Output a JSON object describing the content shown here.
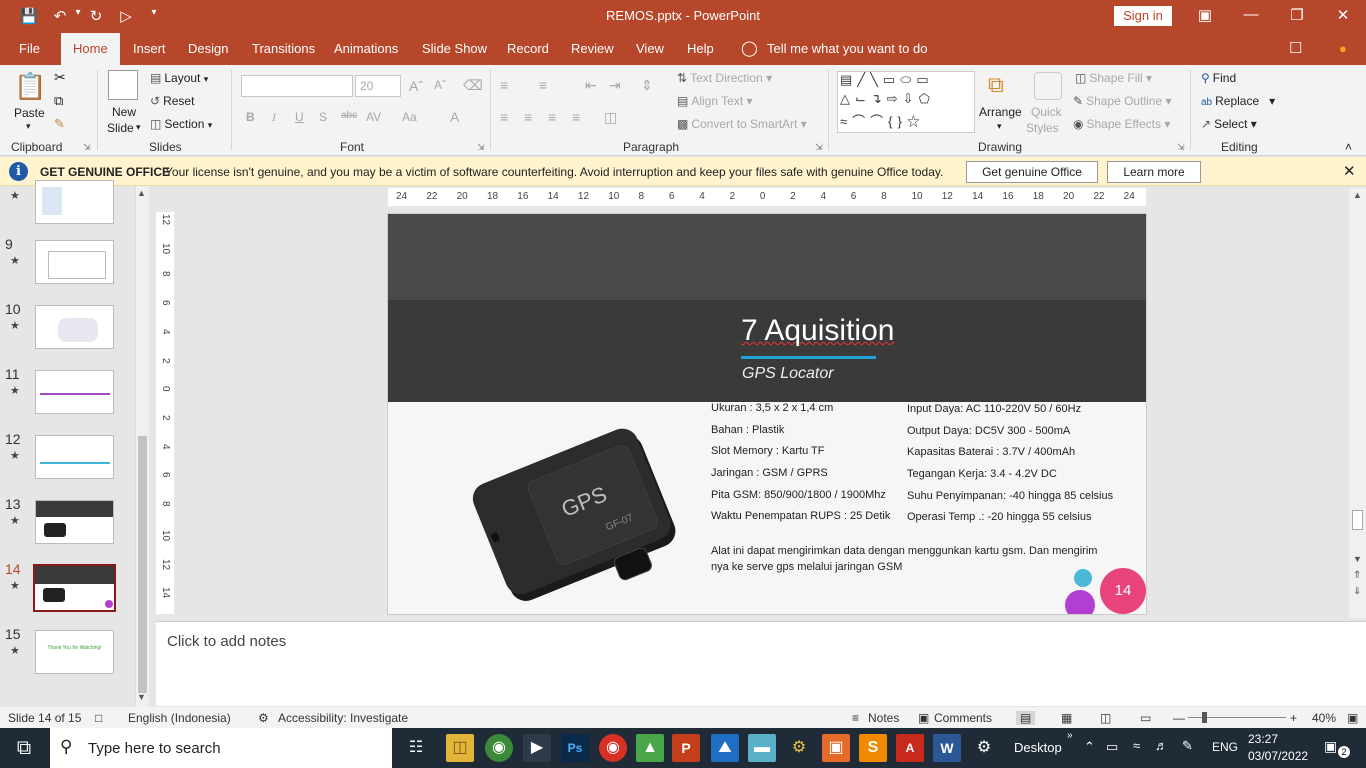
{
  "window": {
    "title": "REMOS.pptx  -  PowerPoint",
    "signin": "Sign in"
  },
  "tabs": [
    "File",
    "Home",
    "Insert",
    "Design",
    "Transitions",
    "Animations",
    "Slide Show",
    "Record",
    "Review",
    "View",
    "Help"
  ],
  "tell_me": "Tell me what you want to do",
  "ribbon": {
    "clipboard": {
      "label": "Clipboard",
      "paste": "Paste"
    },
    "slides": {
      "label": "Slides",
      "new_slide": "New",
      "new_slide2": "Slide",
      "layout": "Layout",
      "reset": "Reset",
      "section": "Section"
    },
    "font": {
      "label": "Font",
      "size": "20",
      "bold": "B",
      "italic": "I",
      "underline": "U",
      "shadow": "S",
      "strike": "abc",
      "spacing": "AV",
      "case": "Aa",
      "color": "A"
    },
    "paragraph": {
      "label": "Paragraph",
      "text_direction": "Text Direction",
      "align_text": "Align Text",
      "convert": "Convert to SmartArt"
    },
    "drawing": {
      "label": "Drawing",
      "arrange": "Arrange",
      "quick_styles": "Quick",
      "quick_styles2": "Styles",
      "shape_fill": "Shape Fill",
      "shape_outline": "Shape Outline",
      "shape_effects": "Shape Effects"
    },
    "editing": {
      "label": "Editing",
      "find": "Find",
      "replace": "Replace",
      "select": "Select"
    }
  },
  "license": {
    "title": "GET GENUINE OFFICE",
    "message": "Your license isn't genuine, and you may be a victim of software counterfeiting. Avoid interruption and keep your files safe with genuine Office today.",
    "btn_genuine": "Get genuine Office",
    "btn_learn": "Learn more"
  },
  "thumbnails": [
    {
      "num": "9"
    },
    {
      "num": "10"
    },
    {
      "num": "11"
    },
    {
      "num": "12"
    },
    {
      "num": "13"
    },
    {
      "num": "14"
    },
    {
      "num": "15",
      "text": "Thank You for Watching!"
    }
  ],
  "ruler_h": [
    "24",
    "22",
    "20",
    "18",
    "16",
    "14",
    "12",
    "10",
    "8",
    "6",
    "4",
    "2",
    "0",
    "2",
    "4",
    "6",
    "8",
    "10",
    "12",
    "14",
    "16",
    "18",
    "20",
    "22",
    "24"
  ],
  "ruler_v": [
    "12",
    "10",
    "8",
    "6",
    "4",
    "2",
    "0",
    "2",
    "4",
    "6",
    "8",
    "10",
    "12",
    "14"
  ],
  "slide": {
    "title": "7 Aquisition",
    "subtitle": "GPS Locator",
    "device_label": "GPS",
    "device_model": "GF-07",
    "left_specs": [
      "Ukuran : 3,5 x 2 x 1,4 cm",
      "Bahan : Plastik",
      "Slot Memory : Kartu TF",
      "Jaringan : GSM / GPRS",
      "Pita GSM: 850/900/1800 / 1900Mhz",
      "Waktu Penempatan RUPS : 25 Detik"
    ],
    "right_specs": [
      "Input Daya: AC 110-220V 50 / 60Hz",
      "Output Daya: DC5V 300 - 500mA",
      "Kapasitas Baterai : 3.7V / 400mAh",
      "Tegangan Kerja: 3.4 - 4.2V DC",
      "Suhu Penyimpanan: -40 hingga 85 celsius",
      "Operasi Temp .: -20 hingga 55 celsius"
    ],
    "description1": "Alat ini dapat mengirimkan data dengan menggunkan kartu gsm. Dan mengirim",
    "description2": "nya ke serve gps melalui jaringan GSM",
    "page_number": "14"
  },
  "notes": "Click to add notes",
  "status": {
    "slide": "Slide 14 of 15",
    "language": "English (Indonesia)",
    "accessibility": "Accessibility: Investigate",
    "notes": "Notes",
    "comments": "Comments",
    "zoom": "40%"
  },
  "taskbar": {
    "search": "Type here to search",
    "desktop": "Desktop",
    "lang": "ENG",
    "time": "23:27",
    "date": "03/07/2022",
    "notif": "2"
  },
  "colors": {
    "accent": "#b7472a",
    "slide_band": "#3a3a3a",
    "slide_top": "#4a4a4a",
    "title_underline": "#1fa3d4",
    "page_circle": "#e8437a",
    "dot_blue": "#4bb8d6",
    "dot_purple": "#b23fd1"
  }
}
